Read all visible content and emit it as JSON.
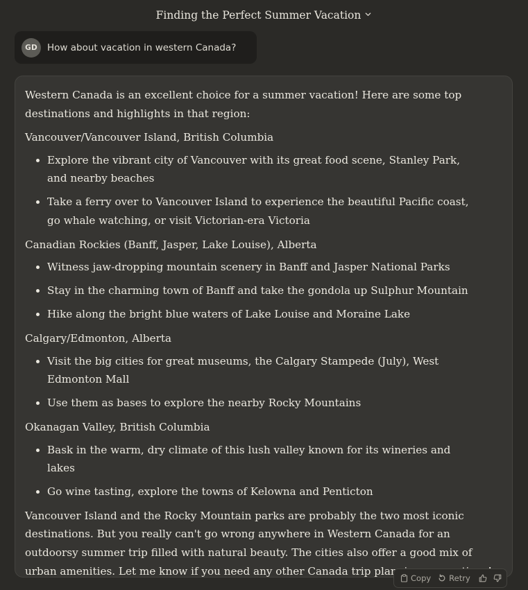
{
  "header": {
    "title": "Finding the Perfect Summer Vacation",
    "chevron_icon": "chevron-down-icon"
  },
  "user_message": {
    "avatar_initials": "GD",
    "text": "How about vacation in western Canada?"
  },
  "reply": {
    "intro": "Western Canada is an excellent choice for a summer vacation! Here are some top destinations and highlights in that region:",
    "sections": [
      {
        "heading": "Vancouver/Vancouver Island, British Columbia",
        "bullets": [
          "Explore the vibrant city of Vancouver with its great food scene, Stanley Park, and nearby beaches",
          "Take a ferry over to Vancouver Island to experience the beautiful Pacific coast, go whale watching, or visit Victorian-era Victoria"
        ]
      },
      {
        "heading": "Canadian Rockies (Banff, Jasper, Lake Louise), Alberta",
        "bullets": [
          "Witness jaw-dropping mountain scenery in Banff and Jasper National Parks",
          "Stay in the charming town of Banff and take the gondola up Sulphur Mountain",
          "Hike along the bright blue waters of Lake Louise and Moraine Lake"
        ]
      },
      {
        "heading": "Calgary/Edmonton, Alberta",
        "bullets": [
          "Visit the big cities for great museums, the Calgary Stampede (July), West Edmonton Mall",
          "Use them as bases to explore the nearby Rocky Mountains"
        ]
      },
      {
        "heading": "Okanagan Valley, British Columbia",
        "bullets": [
          "Bask in the warm, dry climate of this lush valley known for its wineries and lakes",
          "Go wine tasting, explore the towns of Kelowna and Penticton"
        ]
      }
    ],
    "closing": "Vancouver Island and the Rocky Mountain parks are probably the two most iconic destinations. But you really can't go wrong anywhere in Western Canada for an outdoorsy summer trip filled with natural beauty. The cities also offer a good mix of urban amenities. Let me know if you need any other Canada trip planning suggestions!"
  },
  "actions": {
    "copy_label": "Copy",
    "retry_label": "Retry",
    "copy_icon": "clipboard-icon",
    "retry_icon": "retry-icon",
    "thumbs_up_icon": "thumbs-up-icon",
    "thumbs_down_icon": "thumbs-down-icon"
  }
}
